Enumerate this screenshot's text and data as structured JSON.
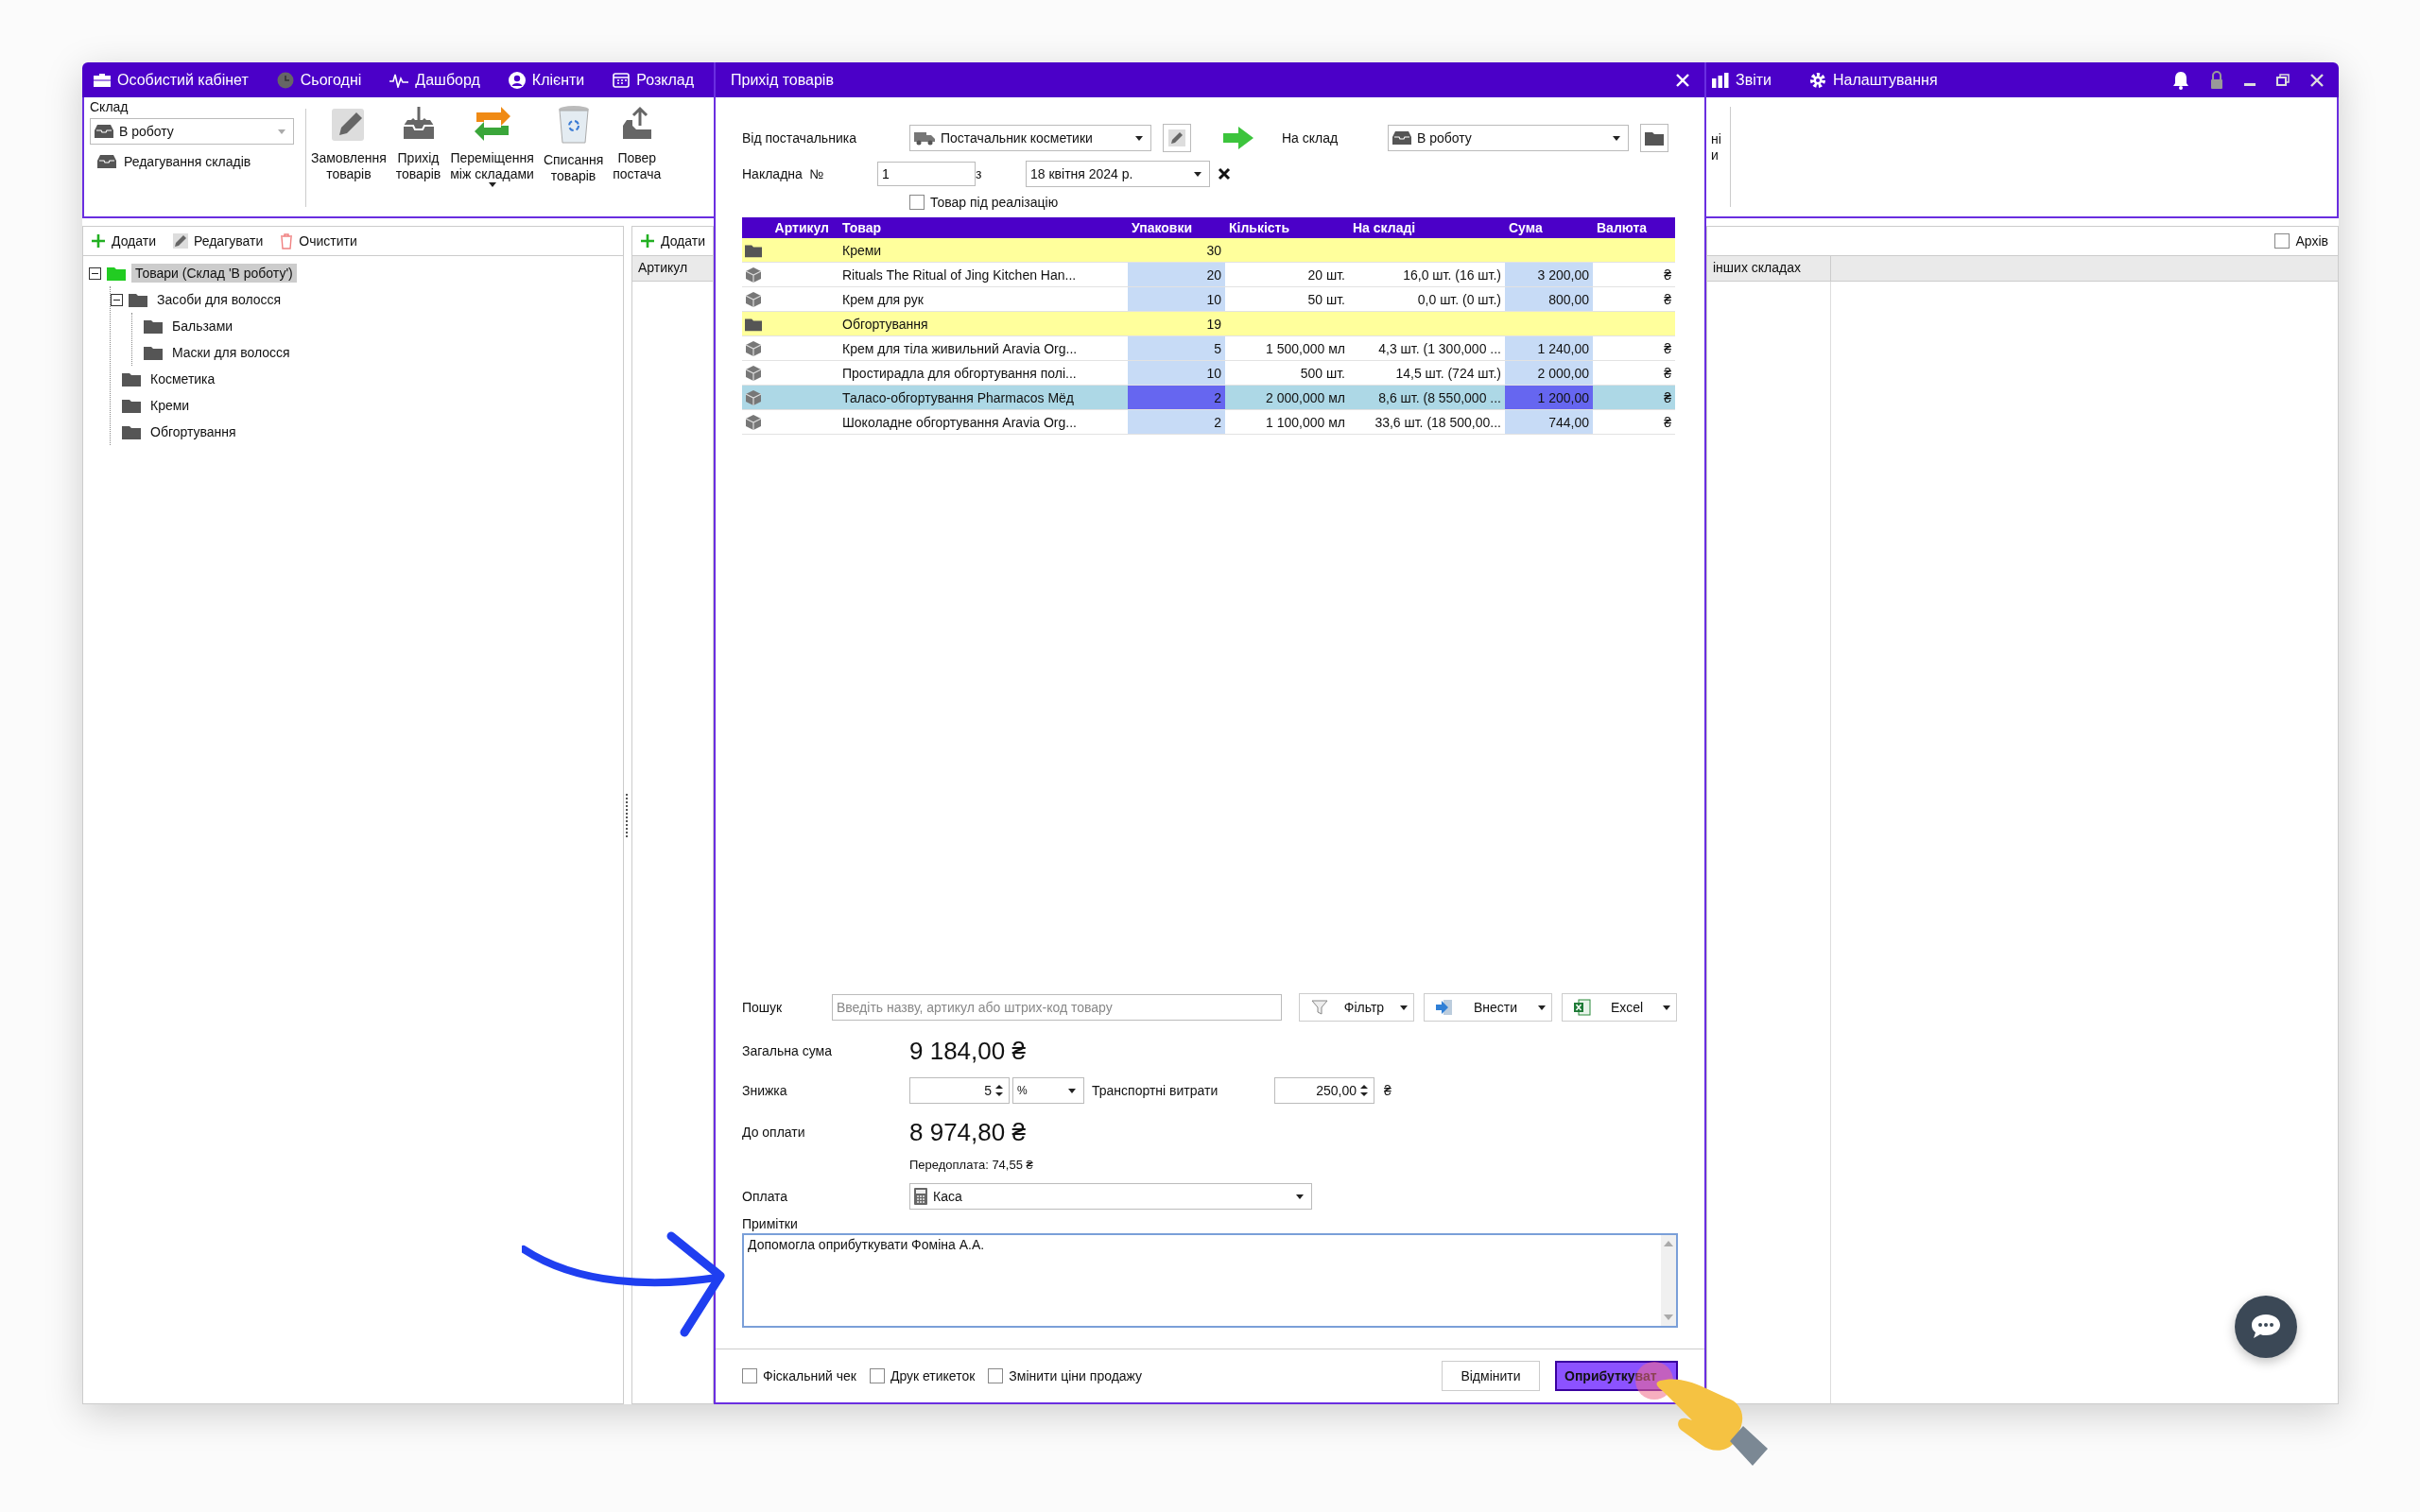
{
  "top_nav": [
    {
      "label": "Особистий кабінет"
    },
    {
      "label": "Сьогодні"
    },
    {
      "label": "Дашборд"
    },
    {
      "label": "Клієнти"
    },
    {
      "label": "Розклад"
    }
  ],
  "top_nav_right": [
    {
      "label": "Звіти"
    },
    {
      "label": "Налаштування"
    }
  ],
  "warehouse_panel": {
    "label": "Склад",
    "value": "В роботу",
    "edit_link": "Редагування складів"
  },
  "ribbon_buttons": [
    {
      "lines": [
        "Замовлення",
        "товарів"
      ],
      "has_menu": false
    },
    {
      "lines": [
        "Прихід",
        "товарів"
      ],
      "has_menu": false
    },
    {
      "lines": [
        "Переміщення",
        "між складами"
      ],
      "has_menu": true
    },
    {
      "lines": [
        "Списання",
        "товарів"
      ],
      "has_menu": false
    },
    {
      "lines": [
        "Повер",
        "постача"
      ],
      "has_menu": false
    }
  ],
  "ribbon_fragment": [
    "ні",
    "и"
  ],
  "tree_toolbar": [
    "Додати",
    "Редагувати",
    "Очистити"
  ],
  "tree": [
    {
      "label": "Товари (Склад 'В роботу')",
      "selected": true,
      "expanded": true,
      "children": [
        {
          "label": "Засоби для волосся",
          "selected": false,
          "expanded": true,
          "children": [
            {
              "label": "Бальзами",
              "selected": false
            },
            {
              "label": "Маски для волосся",
              "selected": false
            }
          ]
        },
        {
          "label": "Косметика",
          "selected": false
        },
        {
          "label": "Креми",
          "selected": false
        },
        {
          "label": "Обгортування",
          "selected": false
        }
      ]
    }
  ],
  "products_panel": {
    "add_button": "Додати",
    "column_1": "Артикул"
  },
  "right_panel": {
    "archive_label": "Архів",
    "archive_checked": false,
    "column_header": "інших складах"
  },
  "dialog": {
    "title": "Прихід товарів",
    "supplier_label": "Від постачальника",
    "supplier": "Постачальник косметики",
    "warehouse_label": "На склад",
    "warehouse": "В роботу",
    "invoice_label": "Накладна  №",
    "invoice_number": "1",
    "date_label": "з",
    "date": "18 квітня 2024 р.",
    "consignment": {
      "label": "Товар під реалізацію",
      "checked": false
    },
    "columns": [
      "Артикул",
      "Товар",
      "Упаковки",
      "Кількість",
      "На складі",
      "Сума",
      "Валюта"
    ],
    "rows": [
      {
        "kind": "group",
        "selected": false,
        "product": "Креми",
        "packages": "30"
      },
      {
        "kind": "item",
        "selected": false,
        "product": "Rituals The Ritual of Jing Kitchen Han...",
        "packages": "20",
        "quantity": "20 шт.",
        "stock": "16,0 шт. (16 шт.)",
        "sum": "3 200,00",
        "currency": "₴"
      },
      {
        "kind": "item",
        "selected": false,
        "product": "Крем для рук",
        "packages": "10",
        "quantity": "50 шт.",
        "stock": "0,0 шт. (0 шт.)",
        "sum": "800,00",
        "currency": "₴"
      },
      {
        "kind": "group",
        "selected": false,
        "product": "Обгортування",
        "packages": "19"
      },
      {
        "kind": "item",
        "selected": false,
        "product": "Крем для тіла живильний Aravia Org...",
        "packages": "5",
        "quantity": "1 500,000 мл",
        "stock": "4,3 шт. (1 300,000 ...",
        "sum": "1 240,00",
        "currency": "₴"
      },
      {
        "kind": "item",
        "selected": false,
        "product": "Простирадла для обгортування полі...",
        "packages": "10",
        "quantity": "500 шт.",
        "stock": "14,5 шт. (724 шт.)",
        "sum": "2 000,00",
        "currency": "₴"
      },
      {
        "kind": "item",
        "selected": true,
        "product": "Таласо-обгортування Pharmacos Мёд",
        "packages": "2",
        "quantity": "2 000,000 мл",
        "stock": "8,6 шт. (8 550,000 ...",
        "sum": "1 200,00",
        "currency": "₴"
      },
      {
        "kind": "item",
        "selected": false,
        "product": "Шоколадне обгортування Aravia Org...",
        "packages": "2",
        "quantity": "1 100,000 мл",
        "stock": "33,6 шт. (18 500,00...",
        "sum": "744,00",
        "currency": "₴"
      }
    ],
    "search": {
      "label": "Пошук",
      "placeholder": "Введіть назву, артикул або штрих-код товару"
    },
    "tool_buttons": [
      "Фільтр",
      "Внести",
      "Excel"
    ],
    "total_label": "Загальна сума",
    "total": "9 184,00 ₴",
    "discount_label": "Знижка",
    "discount": "5",
    "discount_unit": "%",
    "transport_label": "Транспортні витрати",
    "transport": "250,00",
    "transport_currency": "₴",
    "due_label": "До оплати",
    "due": "8 974,80 ₴",
    "prepayment": "Передоплата: 74,55 ₴",
    "payment_label": "Оплата",
    "payment": "Каса",
    "notes_label": "Примітки",
    "notes": "Допомогла оприбуткувати Фоміна А.А.",
    "options": [
      {
        "label": "Фіскальний чек",
        "checked": false
      },
      {
        "label": "Друк етикеток",
        "checked": false
      },
      {
        "label": "Змінити ціни продажу",
        "checked": false
      }
    ],
    "cancel": "Відмінити",
    "submit": "Оприбуткуват"
  }
}
